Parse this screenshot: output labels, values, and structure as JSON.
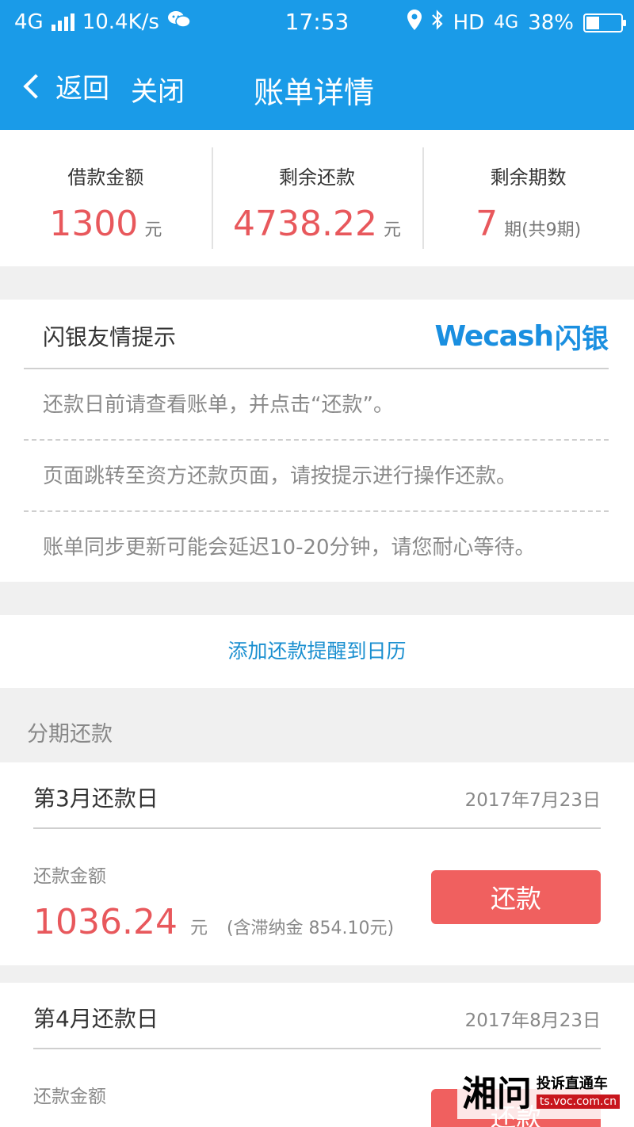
{
  "status_bar": {
    "network": "4G",
    "speed": "10.4K/s",
    "time": "17:53",
    "hd": "HD",
    "network2": "4G",
    "battery": "38%",
    "battery_level": 0.38,
    "icons": [
      "signal-icon",
      "wechat-icon",
      "location-icon",
      "bluetooth-icon",
      "battery-icon"
    ]
  },
  "nav": {
    "back_label": "返回",
    "close_label": "关闭",
    "title": "账单详情"
  },
  "summary": {
    "loan": {
      "label": "借款金额",
      "value": "1300",
      "unit": "元"
    },
    "remaining": {
      "label": "剩余还款",
      "value": "4738.22",
      "unit": "元"
    },
    "periods": {
      "label": "剩余期数",
      "value": "7",
      "unit": "期(共9期)"
    }
  },
  "tips": {
    "title": "闪银友情提示",
    "brand_en": "Wecash",
    "brand_cn": "闪银",
    "items": [
      "还款日前请查看账单，并点击“还款”。",
      "页面跳转至资方还款页面，请按提示进行操作还款。",
      "账单同步更新可能会延迟10-20分钟，请您耐心等待。"
    ]
  },
  "calendar_link": "添加还款提醒到日历",
  "installments": {
    "section_title": "分期还款",
    "items": [
      {
        "title": "第3月还款日",
        "date": "2017年7月23日",
        "amount_label": "还款金额",
        "amount": "1036.24",
        "unit": "元",
        "late_fee": "(含滞纳金 854.10元)",
        "button": "还款"
      },
      {
        "title": "第4月还款日",
        "date": "2017年8月23日",
        "amount_label": "还款金额",
        "button": "还款"
      }
    ]
  },
  "watermark": {
    "big": "湘问",
    "top": "投诉直通车",
    "url": "ts.voc.com.cn"
  },
  "colors": {
    "primary": "#1a9be8",
    "accent_red": "#e8585c",
    "button_red": "#f0605f",
    "link_blue": "#1a8fd0"
  }
}
